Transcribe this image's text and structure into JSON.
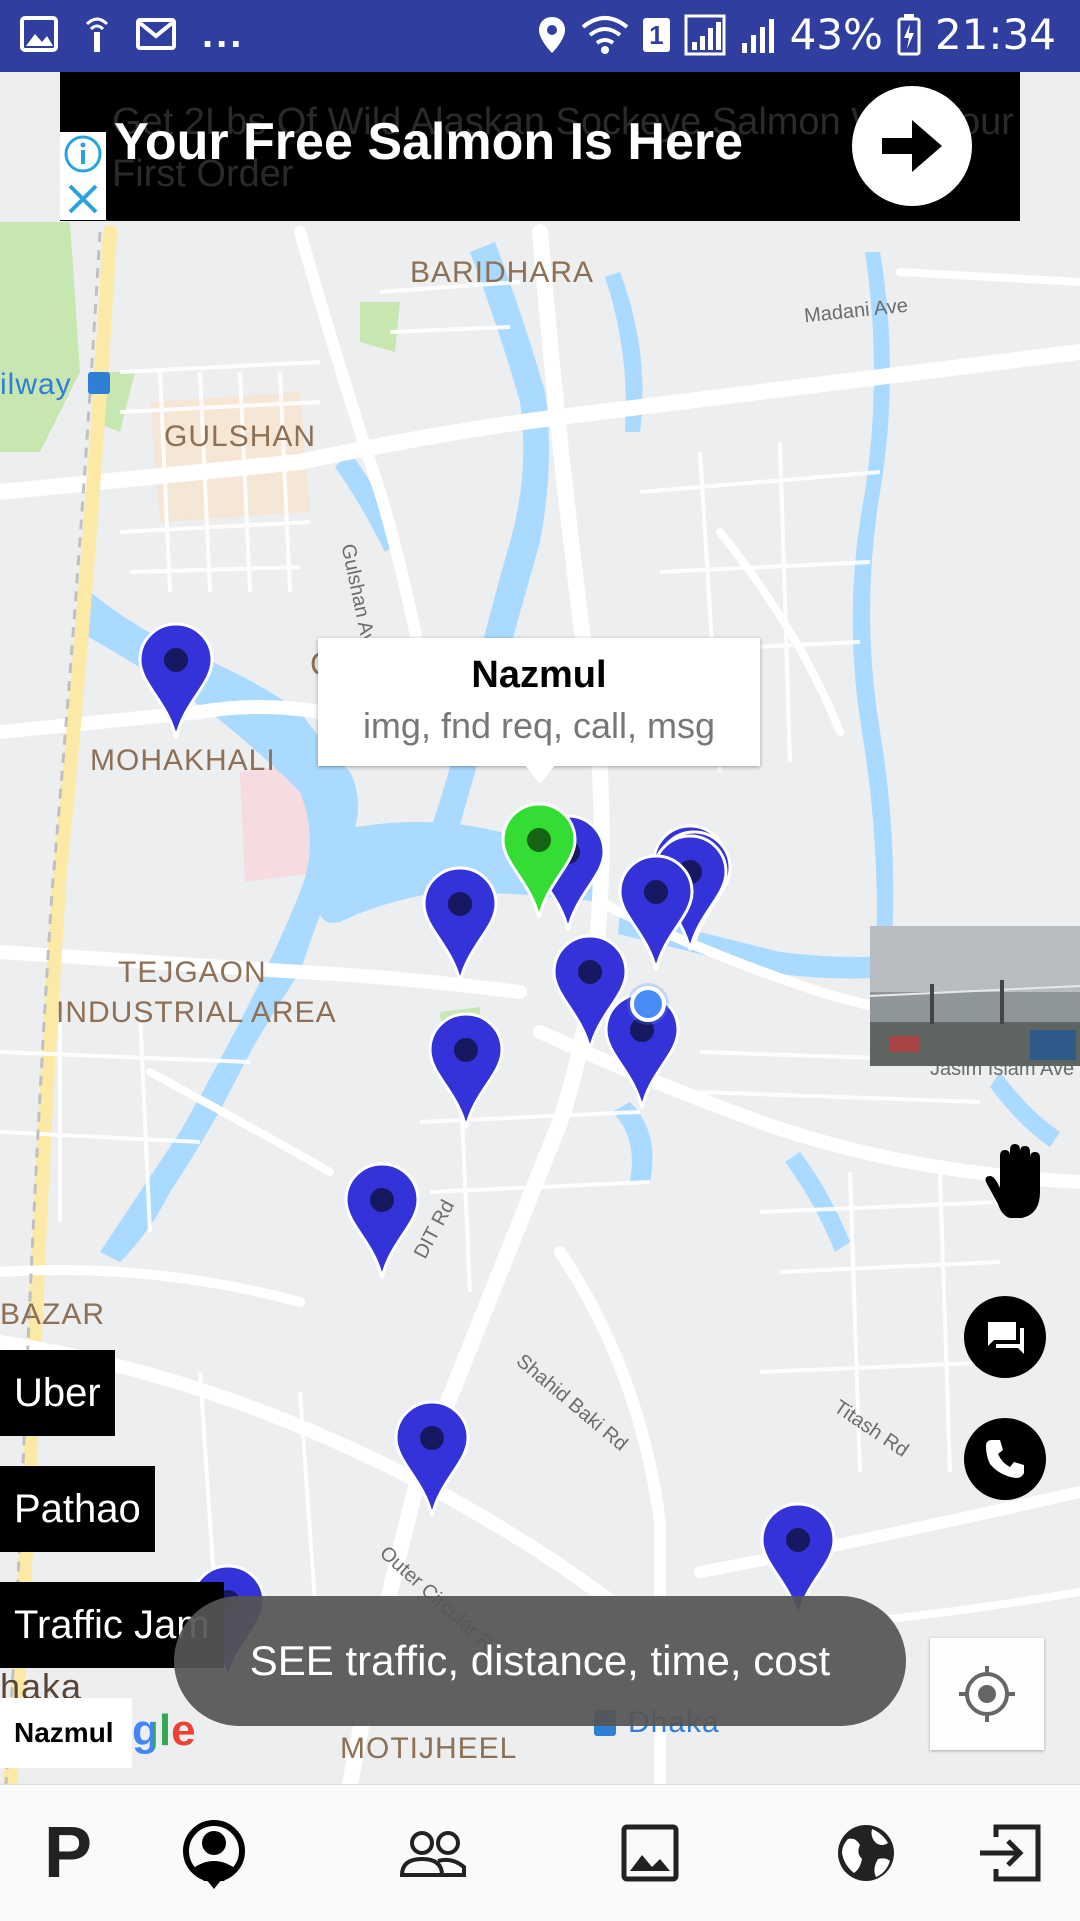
{
  "status_bar": {
    "battery": "43%",
    "time": "21:34",
    "sim_slot": "1",
    "more": "...",
    "icons": [
      "gallery-icon",
      "wifi-hotspot-icon",
      "mail-icon",
      "location-icon",
      "wifi-icon",
      "signal-icon",
      "signal-icon",
      "battery-charging-icon"
    ]
  },
  "ad": {
    "background_text": "Get 2Lbs Of Wild Alaskan Sockeye Salmon With Your First Order",
    "headline": "Your Free Salmon Is Here",
    "icons": [
      "info-icon",
      "close-icon",
      "arrow-right-icon"
    ]
  },
  "map": {
    "place_labels": {
      "baridhara": "BARIDHARA",
      "gulshan": "GULSHAN",
      "mohakhali": "MOHAKHALI",
      "tejgaon_1": "TEJGAON",
      "tejgaon_2": "INDUSTRIAL AREA",
      "bazar": "BAZAR",
      "motijheel": "MOTIJHEEL",
      "dhaka_partial": "haka",
      "railway_partial": "ilway",
      "dhaka_station": "Dhaka",
      "c_partial": "C"
    },
    "road_labels": {
      "madani": "Madani Ave",
      "gulshan_ave": "Gulshan Ave",
      "dit": "DIT Rd",
      "shahid": "Shahid Baki Rd",
      "titash": "Titash Rd",
      "outer": "Outer Circular R",
      "jasim": "Jasim Islam Ave"
    },
    "markers_blue_count": 14,
    "marker_green": "selected-user",
    "info_window": {
      "title": "Nazmul",
      "subtitle": "img, fnd req, call, msg"
    },
    "google_logo": "gle",
    "current_user": "Nazmul"
  },
  "side_buttons": [
    "Uber",
    "Pathao",
    "Traffic Jam"
  ],
  "toast": "SEE traffic, distance, time, cost",
  "floating_icons": [
    "hand-icon",
    "message-icon",
    "phone-icon",
    "my-location-icon"
  ],
  "bottom_nav": [
    {
      "name": "parking-icon",
      "label": "P"
    },
    {
      "name": "profile-icon"
    },
    {
      "name": "friends-icon"
    },
    {
      "name": "image-icon"
    },
    {
      "name": "globe-icon"
    },
    {
      "name": "logout-icon"
    }
  ],
  "colors": {
    "status_bar": "#303f9f",
    "marker_blue": "#3333d9",
    "marker_green": "#33dd33",
    "water": "#aadaff",
    "park": "#c8e6b0"
  }
}
